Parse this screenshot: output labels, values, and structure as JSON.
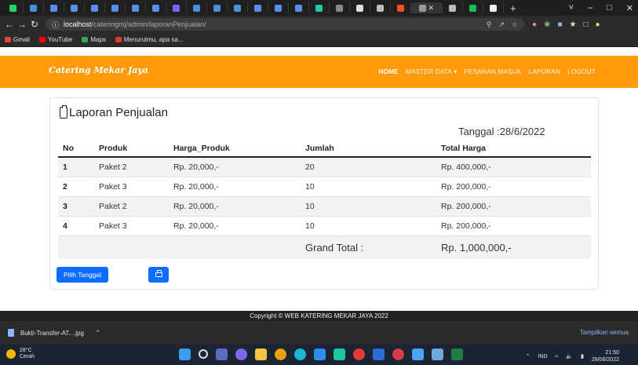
{
  "browser": {
    "url_host": "localhost",
    "url_path": "/cateringmj/admin/laporanPenjualan/",
    "window_controls": [
      "˅",
      "–",
      "□",
      "✕"
    ],
    "tab_close": "✕",
    "bookmarks": [
      {
        "label": "Gmail",
        "color": "#ea4335"
      },
      {
        "label": "YouTube",
        "color": "#ff0000"
      },
      {
        "label": "Maps",
        "color": "#34a853"
      },
      {
        "label": "Menurutmu, apa sa...",
        "color": "#e53935"
      }
    ]
  },
  "site": {
    "brand": "Catering Mekar Jaya",
    "menu": [
      {
        "label": "HOME",
        "active": true
      },
      {
        "label": "MASTER DATA ▾",
        "active": false
      },
      {
        "label": "PESANAN MASUK",
        "active": false
      },
      {
        "label": "LAPORAN",
        "active": false
      },
      {
        "label": "LOGOUT",
        "active": false
      }
    ]
  },
  "report": {
    "title": "Laporan Penjualan",
    "date_text": "Tanggal :28/6/2022",
    "columns": [
      "No",
      "Produk",
      "Harga_Produk",
      "Jumlah",
      "Total Harga"
    ],
    "rows": [
      [
        "1",
        "Paket 2",
        "Rp. 20,000,-",
        "20",
        "Rp. 400,000,-"
      ],
      [
        "2",
        "Paket 3",
        "Rp. 20,000,-",
        "10",
        "Rp. 200,000,-"
      ],
      [
        "3",
        "Paket 2",
        "Rp. 20,000,-",
        "10",
        "Rp. 200,000,-"
      ],
      [
        "4",
        "Paket 3",
        "Rp. 20,000,-",
        "10",
        "Rp. 200,000,-"
      ]
    ],
    "grand_total_label": "Grand Total :",
    "grand_total_value": "Rp. 1,000,000,-",
    "pick_date_button": "Pilih Tanggal",
    "print_icon": "printer-icon"
  },
  "footer": {
    "copyright": "Copyright © WEB KATERING MEKAR JAYA 2022"
  },
  "downloads": {
    "file_name": "Bukti-Transfer-AT....jpg",
    "show_all": "Tampilkan semua"
  },
  "taskbar": {
    "temperature": "28°C",
    "weather": "Cerah",
    "language": "IND",
    "time": "21:50",
    "date": "28/06/2022"
  }
}
